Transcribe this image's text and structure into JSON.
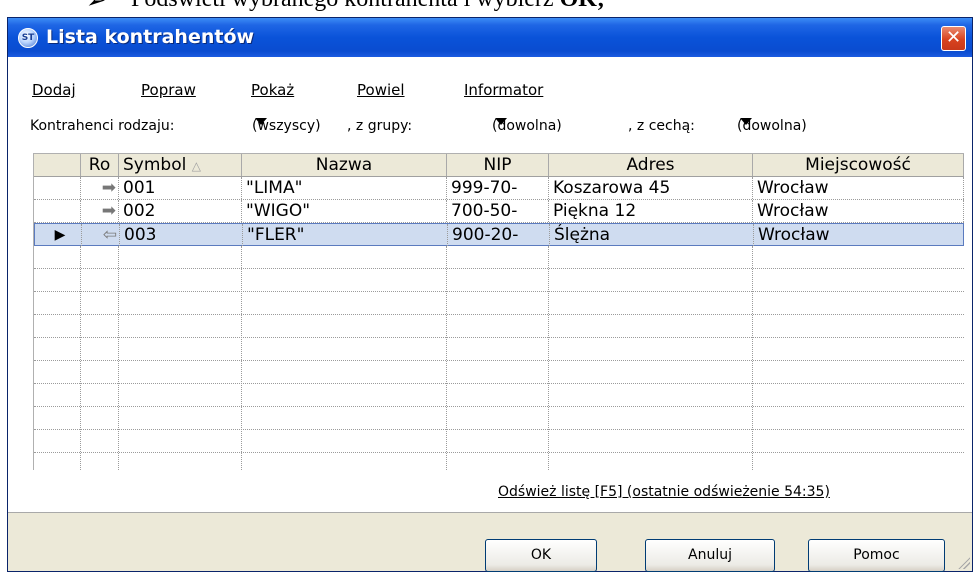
{
  "document": {
    "arrow": "➢",
    "text_before": "Podświetl wybranego kontrahenta i wybierz ",
    "text_bold": "OK;"
  },
  "window": {
    "title": "Lista kontrahentów",
    "icon": "app-logo-icon",
    "icon_text": "ST",
    "close_glyph": "✕"
  },
  "menu": [
    {
      "label": "Dodaj"
    },
    {
      "label": "Popraw"
    },
    {
      "label": "Pokaż"
    },
    {
      "label": "Powiel"
    },
    {
      "label": "Informator"
    }
  ],
  "filters": {
    "kind_label": "Kontrahenci rodzaju:",
    "kind_value": "(wszyscy)",
    "group_label": ", z grupy:",
    "group_value": "(dowolna)",
    "feature_label": ", z cechą:",
    "feature_value": "(dowolna)"
  },
  "grid": {
    "columns": [
      "",
      "Ro",
      "Symbol",
      "Nazwa",
      "NIP",
      "Adres",
      "Miejscowość"
    ],
    "sort_indicator": "△",
    "rows": [
      {
        "indicator": "",
        "direction": "➡",
        "symbol": "001",
        "nazwa": "\"LIMA\"",
        "nip": "999-70-",
        "adres": "Koszarowa 45",
        "miejscowosc": "Wrocław"
      },
      {
        "indicator": "",
        "direction": "➡",
        "symbol": "002",
        "nazwa": "\"WIGO\"",
        "nip": "700-50-",
        "adres": "Piękna 12",
        "miejscowosc": "Wrocław"
      },
      {
        "indicator": "▶",
        "direction": "⇦",
        "symbol": "003",
        "nazwa": "\"FLER\"",
        "nip": "900-20-",
        "adres": "Ślężna",
        "miejscowosc": "Wrocław"
      }
    ]
  },
  "refresh_link": "Odśwież listę [F5] (ostatnie odświeżenie 54:35)",
  "buttons": {
    "ok": "OK",
    "cancel": "Anuluj",
    "help": "Pomoc"
  }
}
